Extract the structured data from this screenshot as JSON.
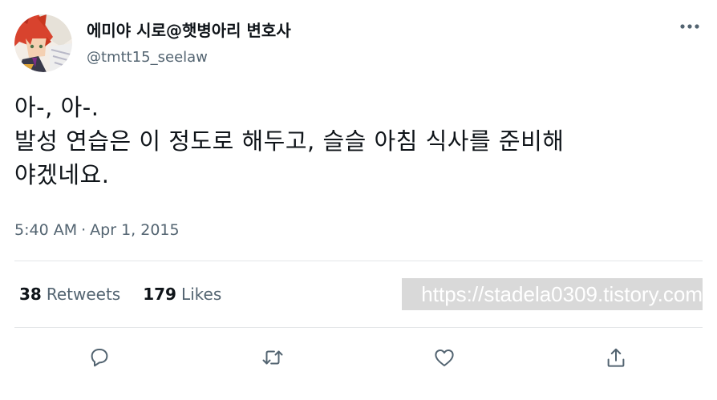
{
  "tweet": {
    "display_name": "에미야 시로@햇병아리 변호사",
    "handle": "@tmtt15_seelaw",
    "text": "아-, 아-.\n발성 연습은 이 정도로 해두고, 슬슬 아침 식사를 준비해\n야겠네요.",
    "time": "5:40 AM",
    "separator": "·",
    "date": "Apr 1, 2015"
  },
  "stats": {
    "retweets_count": "38",
    "retweets_label": "Retweets",
    "likes_count": "179",
    "likes_label": "Likes"
  },
  "watermark": "https://stadela0309.tistory.com",
  "colors": {
    "text_primary": "#0f1419",
    "text_secondary": "#536471",
    "divider": "#e3e6e8",
    "icon": "#536471"
  },
  "icons": {
    "more": "more-horizontal-icon",
    "reply": "reply-bubble-icon",
    "retweet": "retweet-arrows-icon",
    "like": "heart-icon",
    "share": "share-upload-icon"
  }
}
